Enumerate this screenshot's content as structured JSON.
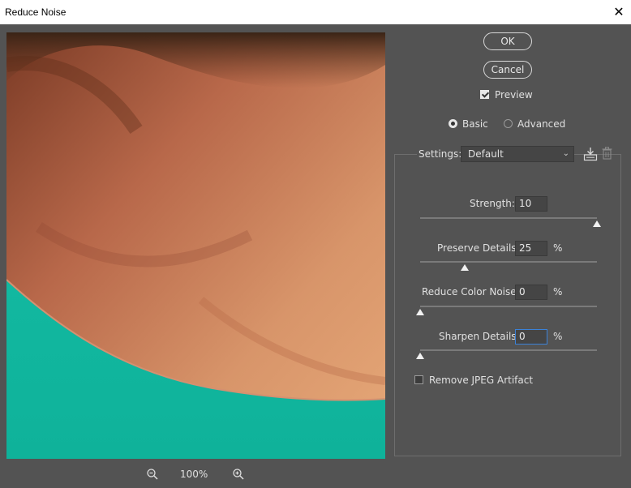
{
  "window": {
    "title": "Reduce Noise",
    "close_glyph": "✕"
  },
  "buttons": {
    "ok": "OK",
    "cancel": "Cancel"
  },
  "preview": {
    "label": "Preview",
    "checked": true
  },
  "mode": {
    "basic": "Basic",
    "advanced": "Advanced",
    "selected": "basic"
  },
  "settings": {
    "label": "Settings:",
    "value": "Default",
    "chevron": "⌄"
  },
  "controls": [
    {
      "id": "strength",
      "label": "Strength:",
      "value": "10",
      "unit": "",
      "fraction": 1.0
    },
    {
      "id": "preserve-details",
      "label": "Preserve Details:",
      "value": "25",
      "unit": "%",
      "fraction": 0.25
    },
    {
      "id": "reduce-color-noise",
      "label": "Reduce Color Noise:",
      "value": "0",
      "unit": "%",
      "fraction": 0.0
    },
    {
      "id": "sharpen-details",
      "label": "Sharpen Details:",
      "value": "0",
      "unit": "%",
      "fraction": 0.0
    }
  ],
  "jpeg": {
    "label": "Remove JPEG Artifact",
    "checked": false
  },
  "zoom": {
    "level": "100%"
  },
  "colors": {
    "panel": "#535353",
    "skin": "#c47e52",
    "shirt": "#13b9a2",
    "focus": "#3b82d8"
  }
}
